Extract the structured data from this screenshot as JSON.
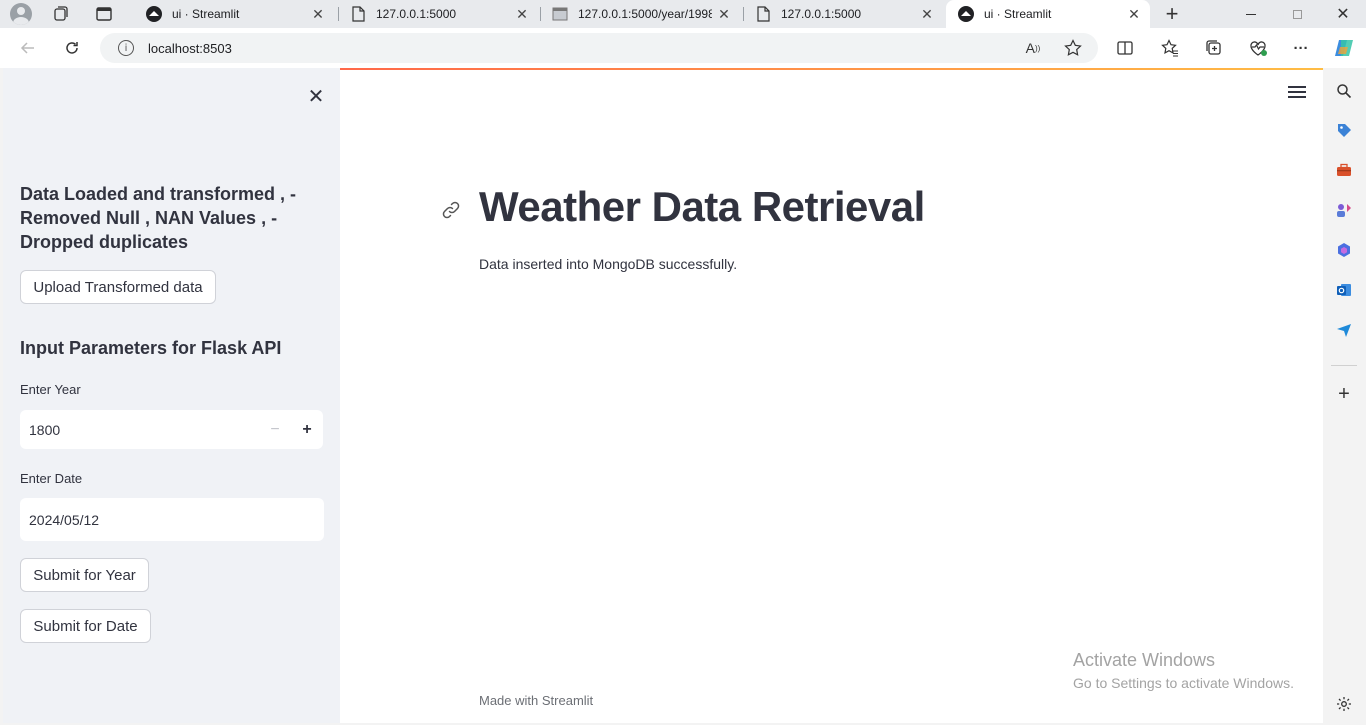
{
  "browser": {
    "tabs": [
      {
        "label": "ui · Streamlit",
        "icon": "streamlit-icon",
        "active": false
      },
      {
        "label": "127.0.0.1:5000",
        "icon": "page-icon",
        "active": false
      },
      {
        "label": "127.0.0.1:5000/year/1998",
        "icon": "terminal-page-icon",
        "active": false
      },
      {
        "label": "127.0.0.1:5000",
        "icon": "page-icon",
        "active": false
      },
      {
        "label": "ui · Streamlit",
        "icon": "streamlit-icon",
        "active": true
      }
    ],
    "new_tab_symbol": "+",
    "address": "localhost:8503"
  },
  "sidebar": {
    "close_symbol": "✕",
    "status_heading": "Data Loaded and transformed , - Removed Null , NAN Values , - Dropped duplicates",
    "upload_button": "Upload Transformed data",
    "params_heading": "Input Parameters for Flask API",
    "year_label": "Enter Year",
    "year_value": "1800",
    "year_minus": "−",
    "year_plus": "+",
    "date_label": "Enter Date",
    "date_value": "2024/05/12",
    "submit_year_button": "Submit for Year",
    "submit_date_button": "Submit for Date"
  },
  "main": {
    "title": "Weather Data Retrieval",
    "message": "Data inserted into MongoDB successfully."
  },
  "footer": {
    "prefix": "Made with",
    "brand": "Streamlit"
  },
  "watermark": {
    "line1": "Activate Windows",
    "line2": "Go to Settings to activate Windows."
  },
  "colors": {
    "accent_red": "#ff4b4b",
    "sidebar_bg": "#f0f2f6",
    "text": "#31333f"
  }
}
